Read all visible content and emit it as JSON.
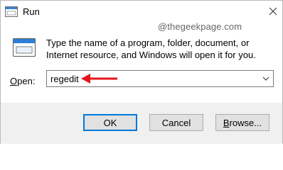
{
  "window": {
    "title": "Run",
    "watermark": "@thegeekpage.com"
  },
  "content": {
    "description": "Type the name of a program, folder, document, or Internet resource, and Windows will open it for you.",
    "open_label_accel": "O",
    "open_label_rest": "pen:",
    "input_value": "regedit"
  },
  "buttons": {
    "ok": "OK",
    "cancel": "Cancel",
    "browse_accel": "B",
    "browse_rest": "rowse..."
  },
  "icons": {
    "app": "run-app-icon",
    "close": "close-icon",
    "run": "run-program-icon",
    "dropdown": "chevron-down-icon",
    "annotation": "red-arrow-icon"
  },
  "colors": {
    "accent": "#0078d7",
    "annotation": "#e8141c",
    "footer": "#f0f0f0"
  }
}
